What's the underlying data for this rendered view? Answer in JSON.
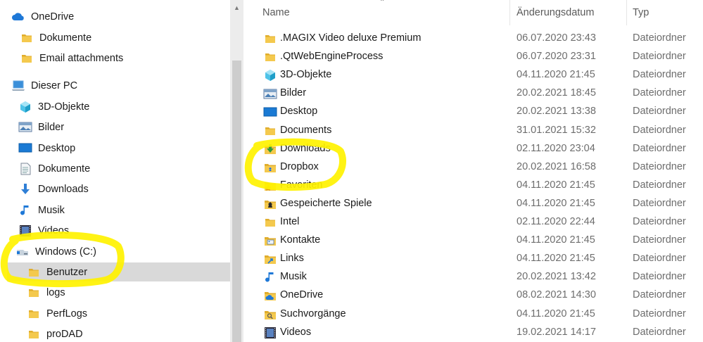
{
  "colors": {
    "highlight": "#fff200",
    "folder": "#f4c94e",
    "selection": "#d9d9d9",
    "accent": "#1e78d7"
  },
  "sidebar": {
    "items": [
      {
        "label": "OneDrive",
        "icon": "onedrive-cloud-icon"
      },
      {
        "label": "Dokumente",
        "icon": "folder-icon"
      },
      {
        "label": "Email attachments",
        "icon": "folder-icon"
      },
      {
        "label": "Dieser PC",
        "icon": "pc-icon"
      },
      {
        "label": "3D-Objekte",
        "icon": "3d-objects-icon"
      },
      {
        "label": "Bilder",
        "icon": "pictures-icon"
      },
      {
        "label": "Desktop",
        "icon": "desktop-icon"
      },
      {
        "label": "Dokumente",
        "icon": "documents-icon"
      },
      {
        "label": "Downloads",
        "icon": "download-arrow-icon"
      },
      {
        "label": "Musik",
        "icon": "music-note-icon"
      },
      {
        "label": "Videos",
        "icon": "film-icon"
      },
      {
        "label": "Windows (C:)",
        "icon": "drive-icon"
      },
      {
        "label": "Benutzer",
        "icon": "folder-icon",
        "selected": true
      },
      {
        "label": "logs",
        "icon": "folder-icon"
      },
      {
        "label": "PerfLogs",
        "icon": "folder-icon"
      },
      {
        "label": "proDAD",
        "icon": "folder-icon"
      }
    ]
  },
  "columns": {
    "name": "Name",
    "date": "Änderungsdatum",
    "type": "Typ"
  },
  "files": [
    {
      "name": ".MAGIX Video deluxe Premium",
      "date": "06.07.2020 23:43",
      "type": "Dateiordner",
      "icon": "folder-icon"
    },
    {
      "name": ".QtWebEngineProcess",
      "date": "06.07.2020 23:31",
      "type": "Dateiordner",
      "icon": "folder-icon"
    },
    {
      "name": "3D-Objekte",
      "date": "04.11.2020 21:45",
      "type": "Dateiordner",
      "icon": "3d-objects-icon"
    },
    {
      "name": "Bilder",
      "date": "20.02.2021 18:45",
      "type": "Dateiordner",
      "icon": "pictures-icon"
    },
    {
      "name": "Desktop",
      "date": "20.02.2021 13:38",
      "type": "Dateiordner",
      "icon": "desktop-icon"
    },
    {
      "name": "Documents",
      "date": "31.01.2021 15:32",
      "type": "Dateiordner",
      "icon": "folder-icon"
    },
    {
      "name": "Downloads",
      "date": "02.11.2020 23:04",
      "type": "Dateiordner",
      "icon": "downloads-folder-icon"
    },
    {
      "name": "Dropbox",
      "date": "20.02.2021 16:58",
      "type": "Dateiordner",
      "icon": "dropbox-folder-icon"
    },
    {
      "name": "Favoriten",
      "date": "04.11.2020 21:45",
      "type": "Dateiordner",
      "icon": "favorites-star-icon"
    },
    {
      "name": "Gespeicherte Spiele",
      "date": "04.11.2020 21:45",
      "type": "Dateiordner",
      "icon": "saved-games-icon"
    },
    {
      "name": "Intel",
      "date": "02.11.2020 22:44",
      "type": "Dateiordner",
      "icon": "folder-icon"
    },
    {
      "name": "Kontakte",
      "date": "04.11.2020 21:45",
      "type": "Dateiordner",
      "icon": "contacts-icon"
    },
    {
      "name": "Links",
      "date": "04.11.2020 21:45",
      "type": "Dateiordner",
      "icon": "links-folder-icon"
    },
    {
      "name": "Musik",
      "date": "20.02.2021 13:42",
      "type": "Dateiordner",
      "icon": "music-note-icon"
    },
    {
      "name": "OneDrive",
      "date": "08.02.2021 14:30",
      "type": "Dateiordner",
      "icon": "onedrive-folder-icon"
    },
    {
      "name": "Suchvorgänge",
      "date": "04.11.2020 21:45",
      "type": "Dateiordner",
      "icon": "searches-folder-icon"
    },
    {
      "name": "Videos",
      "date": "19.02.2021 14:17",
      "type": "Dateiordner",
      "icon": "film-icon"
    }
  ]
}
